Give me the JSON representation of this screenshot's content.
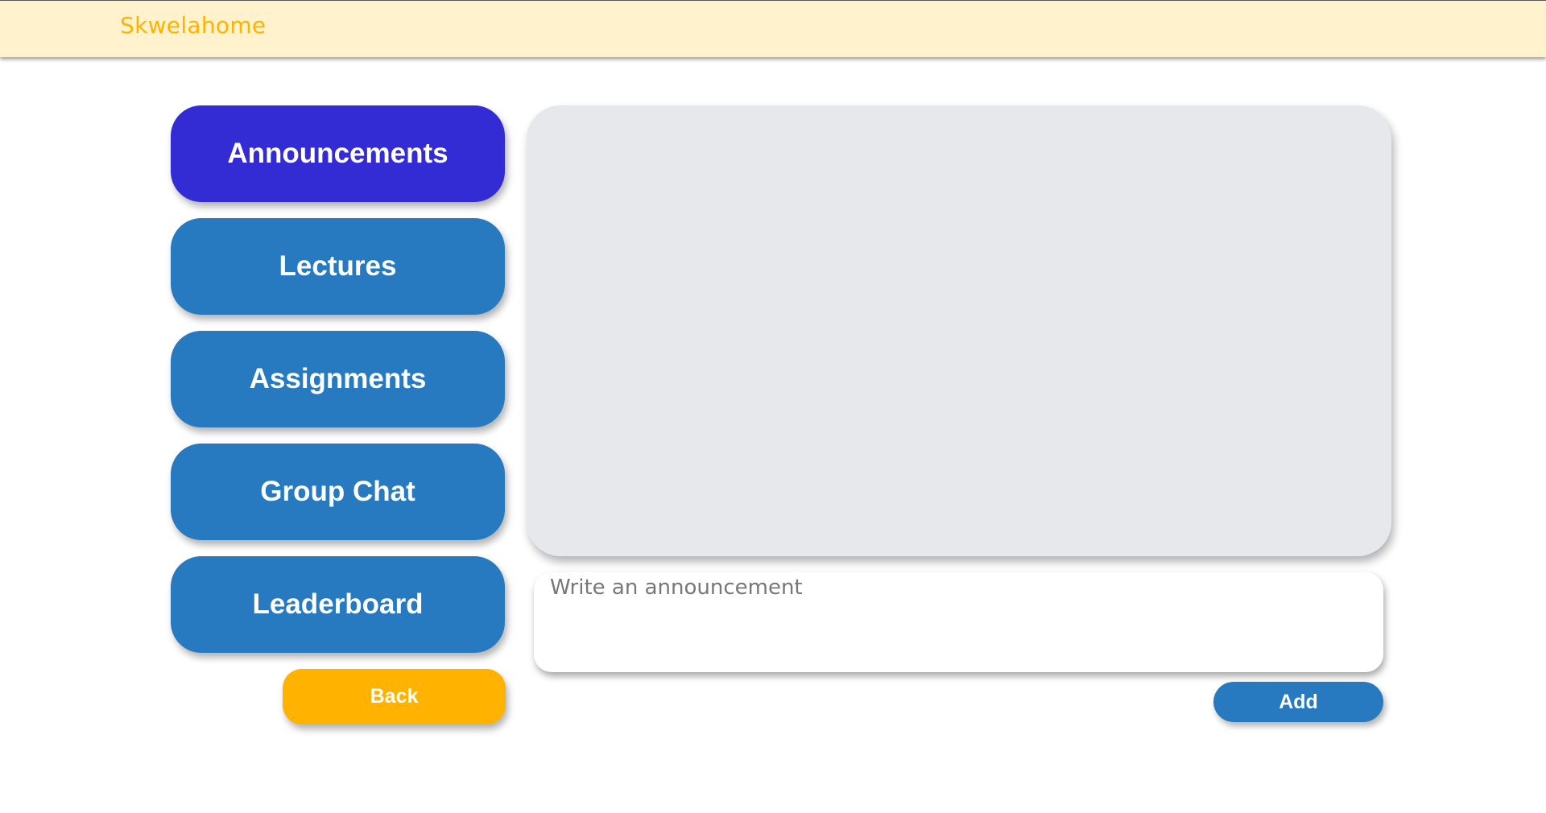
{
  "header": {
    "brand": "Skwelahome",
    "brand_color": "#ffb300",
    "background_color": "#fff2cc"
  },
  "nav": {
    "items": [
      {
        "label": "Announcements",
        "active": true
      },
      {
        "label": "Lectures",
        "active": false
      },
      {
        "label": "Assignments",
        "active": false
      },
      {
        "label": "Group Chat",
        "active": false
      },
      {
        "label": "Leaderboard",
        "active": false
      }
    ],
    "back_label": "Back",
    "active_color": "#332bd4",
    "default_color": "#2779c0",
    "back_color": "#ffb300"
  },
  "composer": {
    "placeholder": "Write an announcement",
    "value": "",
    "add_label": "Add"
  }
}
